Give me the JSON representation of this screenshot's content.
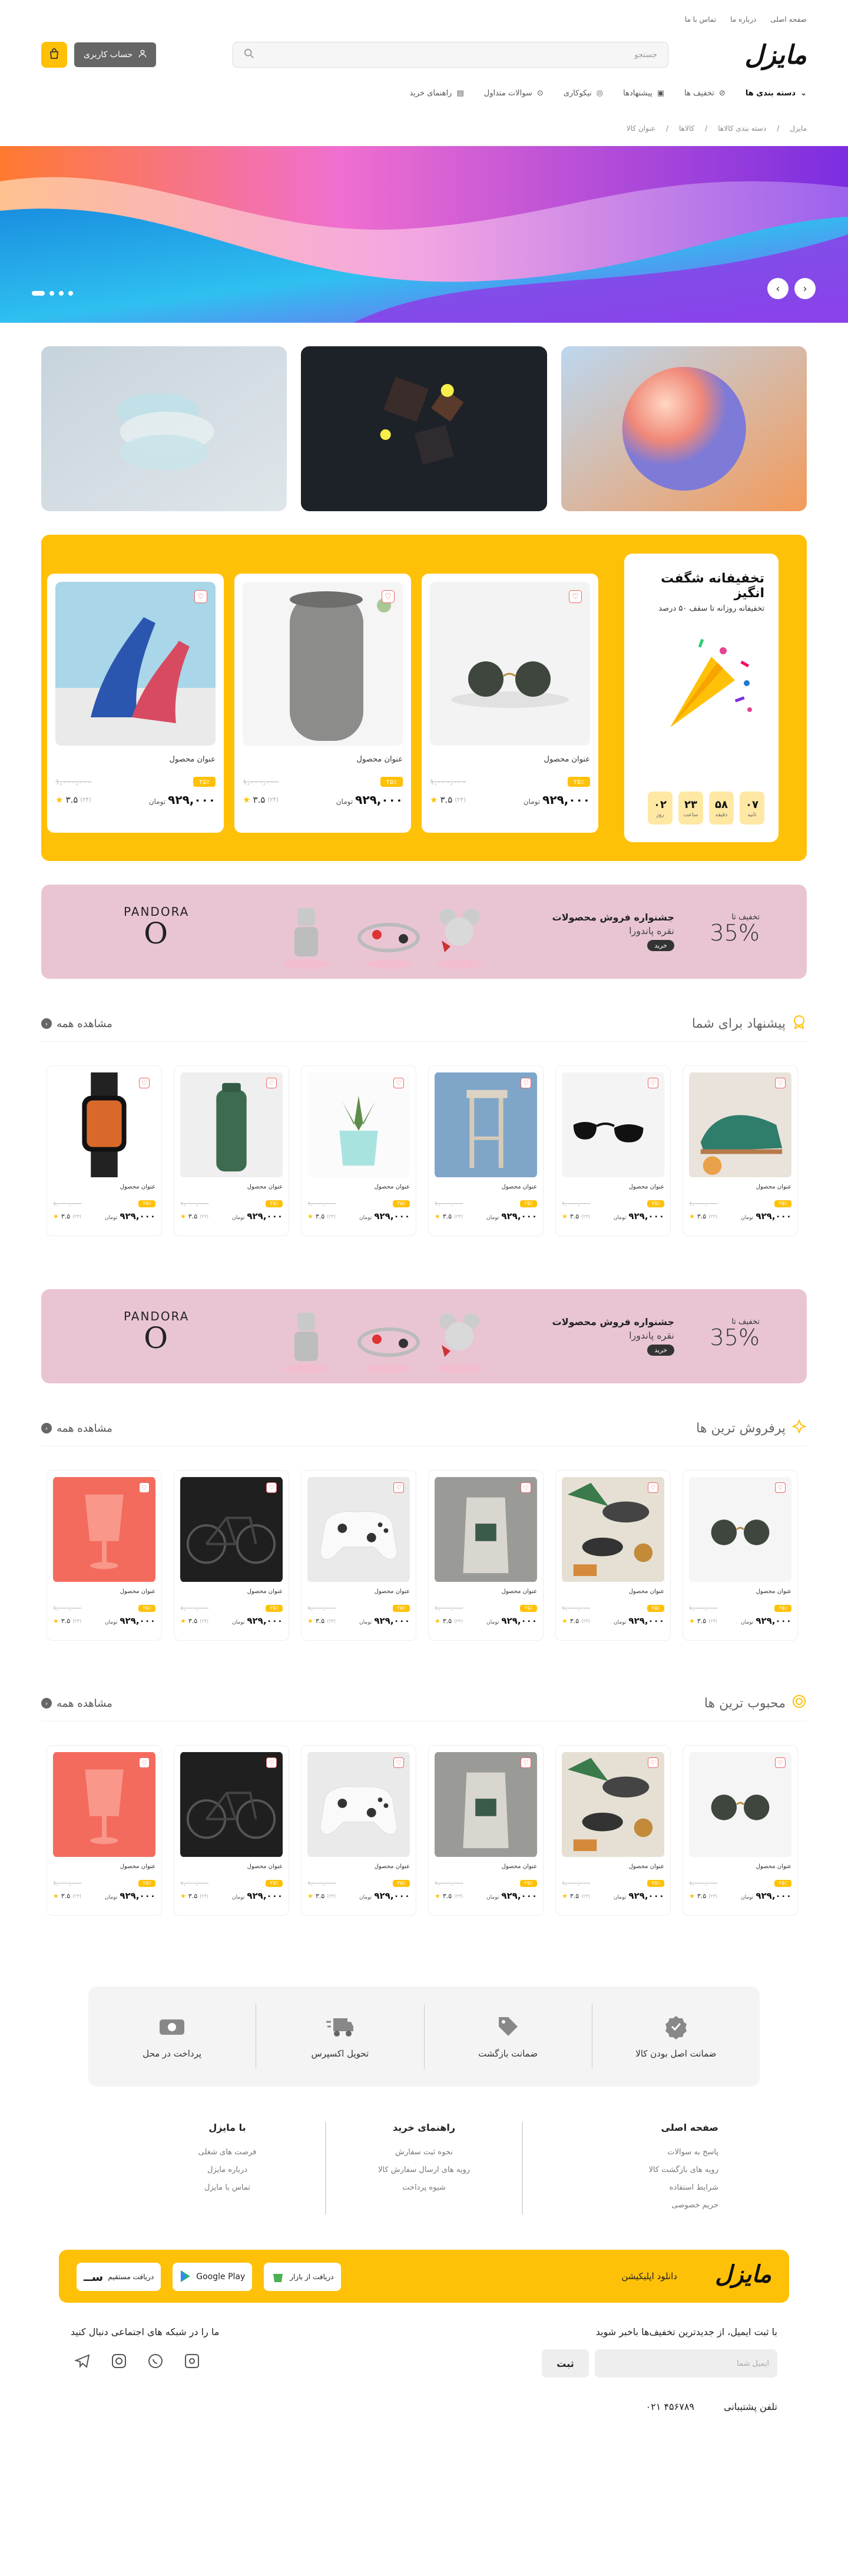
{
  "topnav": [
    "صفحه اصلی",
    "درباره ما",
    "تماس با ما"
  ],
  "header": {
    "logo": "مایزل",
    "search_placeholder": "جستجو",
    "account_label": "حساب کاربری"
  },
  "menu": [
    {
      "label": "دسته بندی ها",
      "icon": "chevron-down-icon"
    },
    {
      "label": "تخفیف ها",
      "icon": "percent-icon"
    },
    {
      "label": "پیشنهادها",
      "icon": "gift-icon"
    },
    {
      "label": "نیکوکاری",
      "icon": "heart-icon"
    },
    {
      "label": "سوالات متداول",
      "icon": "question-icon"
    },
    {
      "label": "راهنمای خرید",
      "icon": "book-icon"
    }
  ],
  "breadcrumb": [
    "مایزل",
    "دسته بندی کالاها",
    "کالاها",
    "عنوان کالا"
  ],
  "amazing": {
    "title": "تخفیفانه شگفت انگیز",
    "subtitle": "تخفیفانه روزانه تا سقف ۵۰ درصد",
    "timer": [
      {
        "v": "۰۷",
        "l": "ثانیه"
      },
      {
        "v": "۵۸",
        "l": "دقیقه"
      },
      {
        "v": "۲۳",
        "l": "ساعت"
      },
      {
        "v": "۰۲",
        "l": "روز"
      }
    ]
  },
  "product": {
    "name": "عنوان محصول",
    "discount": "۲۵٪",
    "old_price": "۱,۰۰۰,۰۰۰",
    "price": "۹۲۹,۰۰۰",
    "currency": "تومان",
    "rating": "۳.۵",
    "count": "(۲۴)"
  },
  "pandora": {
    "brand": "PANDORA",
    "tag": "تخفیف تا",
    "percent": "35%",
    "title": "جشنواره فروش محصولات",
    "sub": "نقره پاندورا",
    "btn": "خرید"
  },
  "sections": [
    {
      "title": "پیشنهاد برای شما",
      "all": "مشاهده همه"
    },
    {
      "title": "پرفروش ترین ها",
      "all": "مشاهده همه"
    },
    {
      "title": "محبوب ترین ها",
      "all": "مشاهده همه"
    }
  ],
  "features": [
    "ضمانت اصل بودن کالا",
    "ضمانت بازگشت",
    "تحویل اکسپرس",
    "پرداخت در محل"
  ],
  "footer": {
    "cols": [
      {
        "title": "صفحه اصلی",
        "links": [
          "پاسخ به سوالات",
          "رویه های بازگشت کالا",
          "شرایط استفاده",
          "حریم خصوصی"
        ]
      },
      {
        "title": "راهنمای خرید",
        "links": [
          "نحوه ثبت سفارش",
          "رویه های ارسال سفارش کالا",
          "شیوه پرداخت"
        ]
      },
      {
        "title": "با مایزل",
        "links": [
          "فرصت های شغلی",
          "درباره مایزل",
          "تماس با مایزل"
        ]
      }
    ],
    "app_title": "دانلود اپلیکیشن",
    "stores": [
      "دریافت از بازار",
      "Google Play",
      "دریافت مستقیم"
    ],
    "newsletter": "با ثبت ایمیل، از جدیدترین تخفیف‌ها باخبر شوید",
    "email_placeholder": "ایمیل شما",
    "submit": "ثبت",
    "social_title": "ما را در شبکه های اجتماعی دنبال کنید",
    "support_label": "تلفن پشتیبانی",
    "support_phone": "۰۲۱ ۴۵۶۷۸۹"
  }
}
